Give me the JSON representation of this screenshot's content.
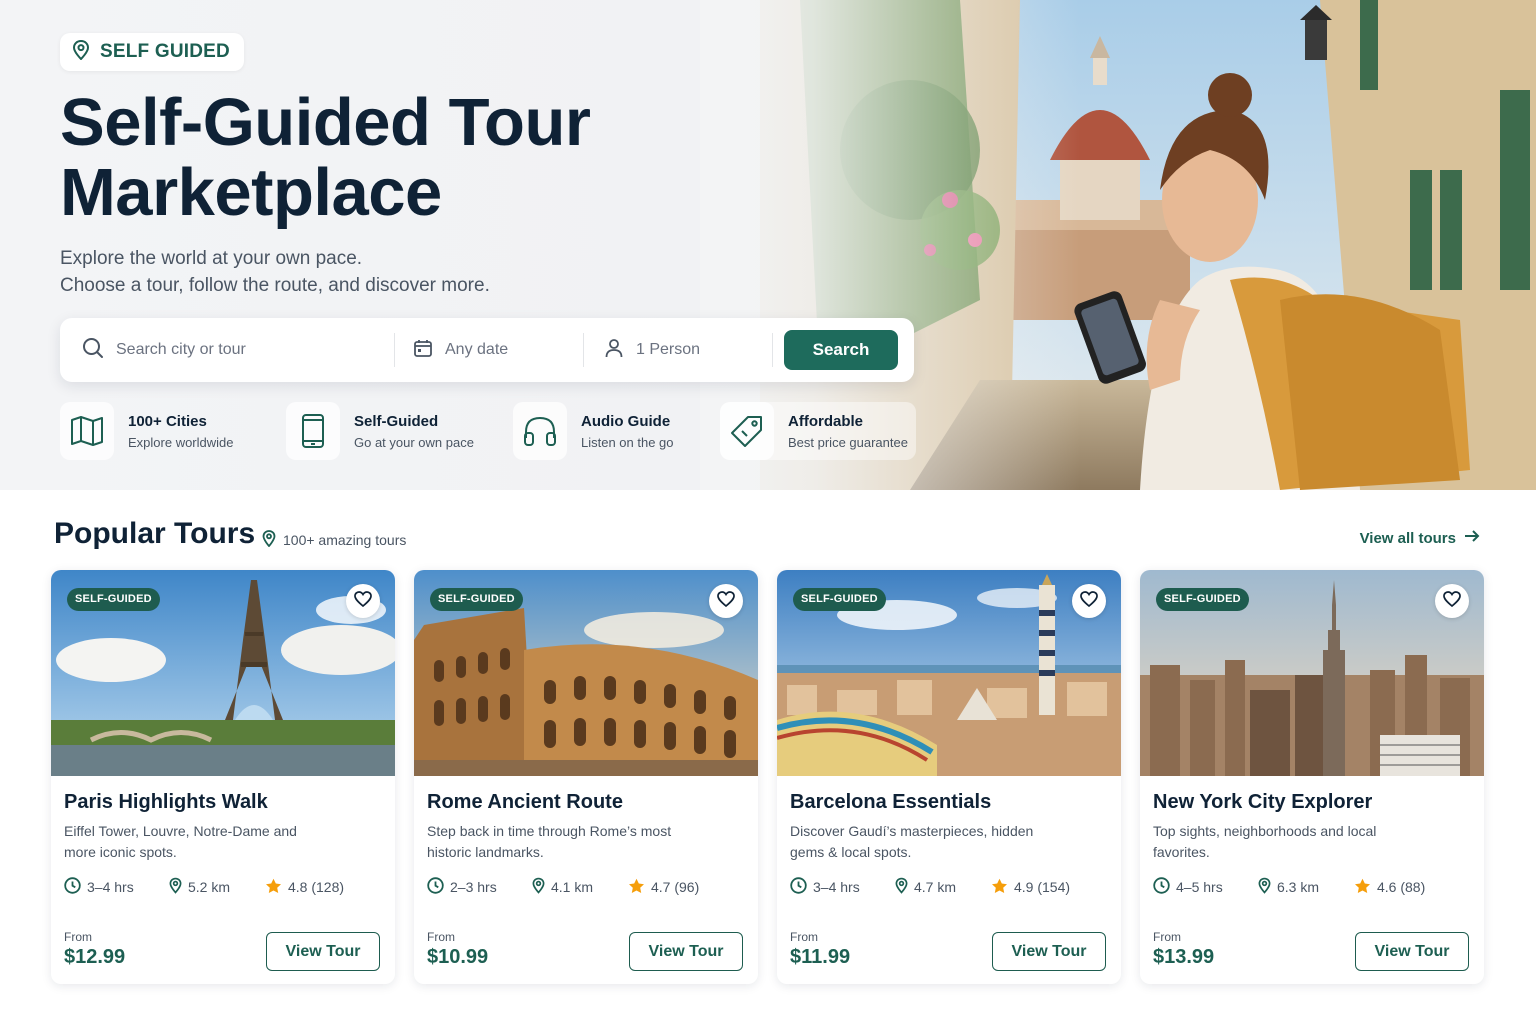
{
  "hero": {
    "tag": "SELF GUIDED",
    "title_line1": "Self-Guided Tour",
    "title_line2": "Marketplace",
    "subtitle_line1": "Explore the world at your own pace.",
    "subtitle_line2": "Choose a tour, follow the route, and discover more."
  },
  "search": {
    "city_placeholder": "Search city or tour",
    "date_value": "Any date",
    "people_value": "1 Person",
    "button_label": "Search"
  },
  "features": [
    {
      "title": "100+ Cities",
      "desc": "Explore worldwide",
      "icon": "map-icon"
    },
    {
      "title": "Self-Guided",
      "desc": "Go at your own pace",
      "icon": "phone-icon"
    },
    {
      "title": "Audio Guide",
      "desc": "Listen on the go",
      "icon": "headphones-icon"
    },
    {
      "title": "Affordable",
      "desc": "Best price guarantee",
      "icon": "tag-icon"
    }
  ],
  "popular": {
    "title": "Popular Tours",
    "count": "100+ amazing tours",
    "view_all": "View all tours"
  },
  "tours": [
    {
      "badge": "SELF-GUIDED",
      "title": "Paris Highlights Walk",
      "desc": "Eiffel Tower, Louvre, Notre-Dame and more iconic spots.",
      "duration": "3–4 hrs",
      "distance": "5.2 km",
      "rating": "4.8 (128)",
      "from": "From",
      "price": "$12.99",
      "button": "View Tour"
    },
    {
      "badge": "SELF-GUIDED",
      "title": "Rome Ancient Route",
      "desc": "Step back in time through Rome’s most historic landmarks.",
      "duration": "2–3 hrs",
      "distance": "4.1 km",
      "rating": "4.7 (96)",
      "from": "From",
      "price": "$10.99",
      "button": "View Tour"
    },
    {
      "badge": "SELF-GUIDED",
      "title": "Barcelona Essentials",
      "desc": "Discover Gaudí’s masterpieces, hidden gems & local spots.",
      "duration": "3–4 hrs",
      "distance": "4.7 km",
      "rating": "4.9 (154)",
      "from": "From",
      "price": "$11.99",
      "button": "View Tour"
    },
    {
      "badge": "SELF-GUIDED",
      "title": "New York City Explorer",
      "desc": "Top sights, neighborhoods and local favorites.",
      "duration": "4–5 hrs",
      "distance": "6.3 km",
      "rating": "4.6 (88)",
      "from": "From",
      "price": "$13.99",
      "button": "View Tour"
    }
  ],
  "colors": {
    "accent": "#1e6b5c",
    "heading": "#0f2236",
    "star": "#f59e0b"
  }
}
